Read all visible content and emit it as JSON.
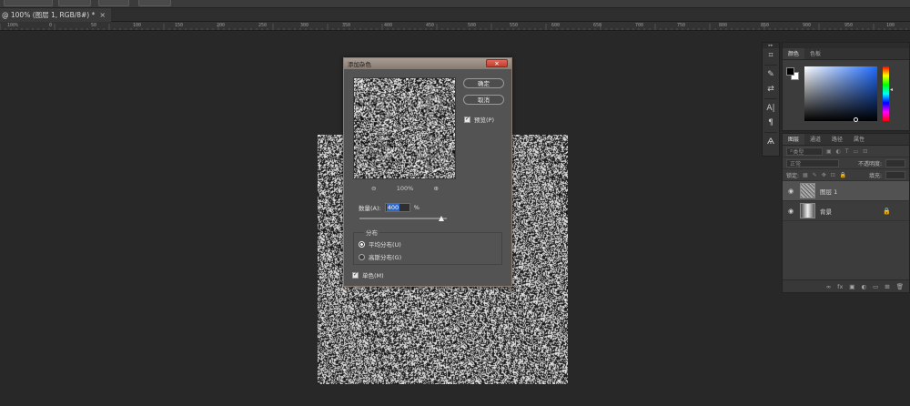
{
  "document": {
    "tab_title": "@ 100% (图层 1, RGB/8#) *",
    "close_glyph": "×"
  },
  "ruler": {
    "labels": [
      "100%",
      "0",
      "50",
      "100",
      "150",
      "200",
      "250",
      "300",
      "350",
      "400",
      "450",
      "500",
      "550",
      "600",
      "650",
      "700",
      "750",
      "800",
      "850",
      "900",
      "950",
      "100"
    ]
  },
  "tools": {
    "items": [
      {
        "name": "history-icon",
        "glyph": "⌗"
      },
      {
        "name": "brush-icon",
        "glyph": "✎"
      },
      {
        "name": "adjust-icon",
        "glyph": "⇄"
      },
      {
        "name": "text-icon",
        "glyph": "A|"
      },
      {
        "name": "paragraph-icon",
        "glyph": "¶"
      },
      {
        "name": "glyph-icon",
        "glyph": "Ѧ"
      }
    ]
  },
  "color_panel": {
    "tabs": [
      "颜色",
      "色板"
    ]
  },
  "layers_panel": {
    "tabs": [
      "图层",
      "通道",
      "路径",
      "属性"
    ],
    "filter_label": "类型",
    "blend_mode": "正常",
    "opacity_label": "不透明度:",
    "lock_label": "锁定:",
    "fill_label": "填充:",
    "layers": [
      {
        "name": "图层 1",
        "selected": true
      },
      {
        "name": "背景",
        "selected": false
      }
    ],
    "footer_icons": [
      "∞",
      "fx",
      "▣",
      "◐",
      "▭",
      "⊞",
      "🗑"
    ]
  },
  "dialog": {
    "title": "添加杂色",
    "close_glyph": "✕",
    "ok_label": "确定",
    "cancel_label": "取消",
    "preview_label": "预览(P)",
    "preview_checked": true,
    "zoom_level": "100%",
    "zoom_out_glyph": "⊖",
    "zoom_in_glyph": "⊕",
    "amount_label": "数量(A):",
    "amount_value": "400",
    "amount_unit": "%",
    "distribution_title": "分布",
    "distribution_options": [
      {
        "label": "平均分布(U)",
        "selected": true
      },
      {
        "label": "高斯分布(G)",
        "selected": false
      }
    ],
    "monochrome_label": "单色(M)",
    "monochrome_checked": true
  }
}
